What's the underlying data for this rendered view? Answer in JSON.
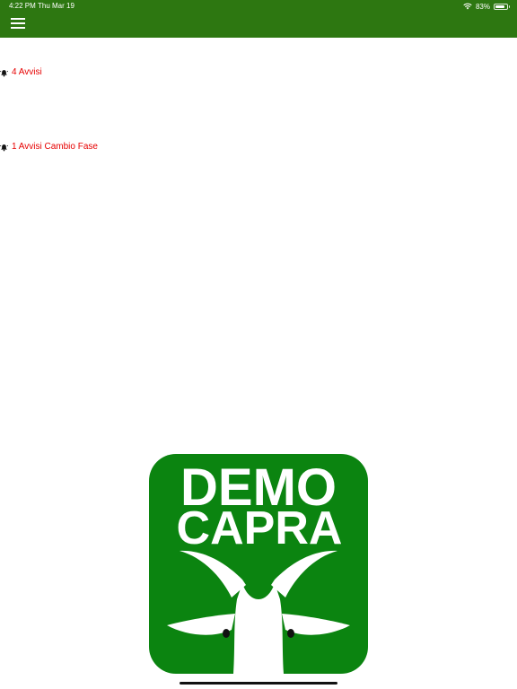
{
  "status_bar": {
    "time": "4:22 PM",
    "date": "Thu Mar 19",
    "battery": "83%",
    "battery_level": 0.83
  },
  "navbar": {
    "background": "#2d7711",
    "menu_icon": "hamburger-menu-icon"
  },
  "alerts": [
    {
      "icon": "alarm-bell-icon",
      "label": "4 Avvisi",
      "color": "#e60000"
    },
    {
      "icon": "alarm-bell-icon",
      "label": "1 Avvisi Cambio Fase",
      "color": "#e60000"
    }
  ],
  "logo": {
    "line1": "DEMO",
    "line2": "CAPRA",
    "background": "#0b8410"
  }
}
